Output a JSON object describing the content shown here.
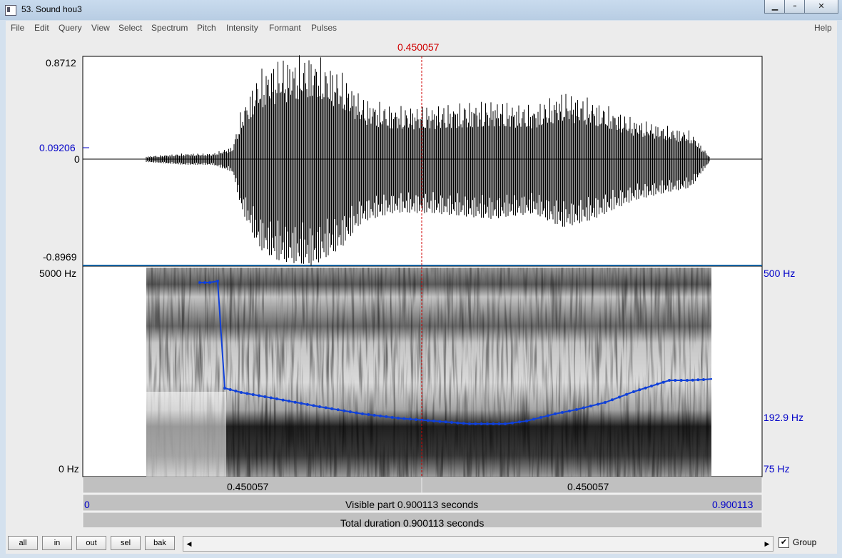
{
  "window": {
    "title": "53. Sound hou3",
    "minimize": "▁",
    "maximize": "▫",
    "close": "✕"
  },
  "menu": [
    "File",
    "Edit",
    "Query",
    "View",
    "Select",
    "Spectrum",
    "Pitch",
    "Intensity",
    "Formant",
    "Pulses"
  ],
  "help": "Help",
  "cursor": {
    "time_label": "0.450057",
    "color": "#d00000"
  },
  "waveform": {
    "max_label": "0.8712",
    "cursor_value_label": "0.09206",
    "zero_label": "0",
    "min_label": "-0.8969"
  },
  "spectrogram": {
    "top_label": "5000 Hz",
    "bottom_label": "0 Hz"
  },
  "pitch": {
    "top_label": "500 Hz",
    "value_label": "192.9 Hz",
    "bottom_label": "75 Hz",
    "color": "#1040d8"
  },
  "time_bar": {
    "left_label": "0.450057",
    "right_label": "0.450057",
    "visible_start": "0",
    "visible_text": "Visible part 0.900113 seconds",
    "visible_end": "0.900113",
    "total_text": "Total duration 0.900113 seconds"
  },
  "buttons": {
    "all": "all",
    "in": "in",
    "out": "out",
    "sel": "sel",
    "bak": "bak"
  },
  "scroll": {
    "left_arrow": "◀",
    "right_arrow": "▶"
  },
  "group": {
    "label": "Group",
    "checked": "✔"
  }
}
